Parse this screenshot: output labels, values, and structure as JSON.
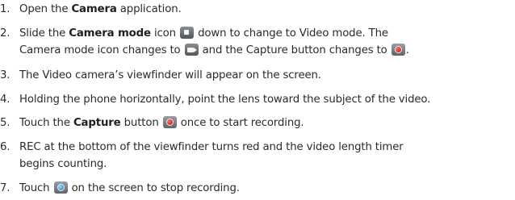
{
  "steps": [
    {
      "num": "1.",
      "t1": "Open the ",
      "b1": "Camera",
      "t2": " application."
    },
    {
      "num": "2.",
      "t1": "Slide the ",
      "b1": "Camera mode",
      "t2": " icon ",
      "icon1": "camera-mode-icon",
      "t3": " down to change to Video mode. The",
      "line2a": "Camera mode icon changes to ",
      "icon2": "video-mode-icon",
      "line2b": " and the Capture button changes to ",
      "icon3": "record-button-icon",
      "line2c": "."
    },
    {
      "num": "3.",
      "t1": "The Video camera’s viewfinder will appear on the screen."
    },
    {
      "num": "4.",
      "t1": "Holding the phone horizontally, point the lens toward the subject of the video."
    },
    {
      "num": "5.",
      "t1": "Touch the ",
      "b1": "Capture",
      "t2": " button ",
      "icon1": "record-button-icon",
      "t3": " once to start recording."
    },
    {
      "num": "6.",
      "t1": "REC at the bottom of the viewfinder turns red and the video length timer",
      "line2a": "begins counting."
    },
    {
      "num": "7.",
      "t1": "Touch ",
      "icon1": "stop-button-icon",
      "t2": " on the screen to stop recording."
    }
  ]
}
